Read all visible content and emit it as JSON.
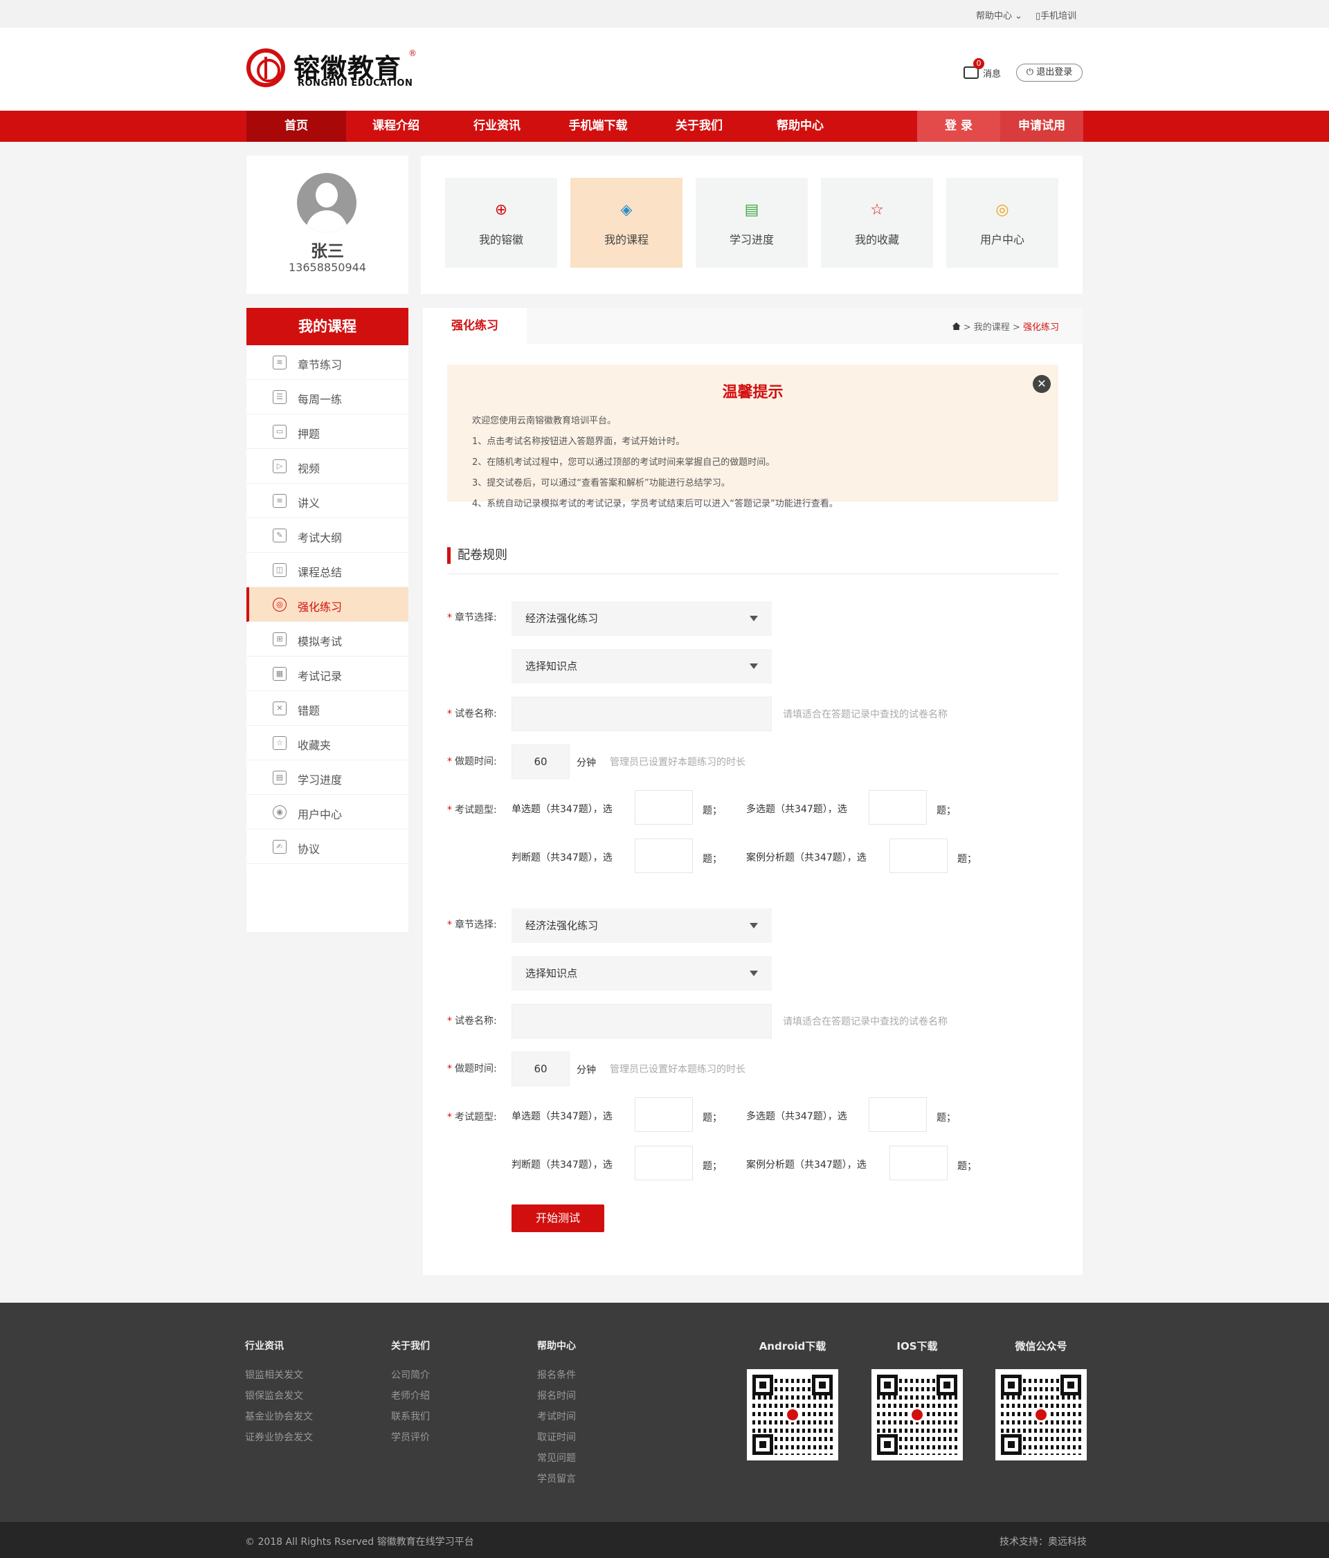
{
  "topbar": {
    "help": "帮助中心",
    "mobile": "手机培训"
  },
  "brand": {
    "name_cn": "镕徽教育",
    "name_en": "RONGHUI EDUCATION",
    "reg": "®",
    "color": "#d20f0f"
  },
  "header": {
    "message_label": "消息",
    "message_count": "0",
    "logout": "退出登录"
  },
  "nav": {
    "items": [
      "首页",
      "课程介绍",
      "行业资讯",
      "手机端下载",
      "关于我们",
      "帮助中心"
    ],
    "active_index": 0,
    "login": "登 录",
    "trial": "申请试用"
  },
  "profile": {
    "name": "张三",
    "phone": "13658850944"
  },
  "tiles": [
    {
      "label": "我的镕徽",
      "icon": "ronghui-logo-icon"
    },
    {
      "label": "我的课程",
      "icon": "layers-icon"
    },
    {
      "label": "学习进度",
      "icon": "progress-icon"
    },
    {
      "label": "我的收藏",
      "icon": "star-icon"
    },
    {
      "label": "用户中心",
      "icon": "user-icon"
    }
  ],
  "tiles_active_index": 1,
  "sidebar": {
    "title": "我的课程",
    "items": [
      "章节练习",
      "每周一练",
      "押题",
      "视频",
      "讲义",
      "考试大纲",
      "课程总结",
      "强化练习",
      "模拟考试",
      "考试记录",
      "错题",
      "收藏夹",
      "学习进度",
      "用户中心",
      "协议"
    ],
    "active_index": 7
  },
  "main": {
    "tab": "强化练习",
    "breadcrumb": [
      "我的课程",
      "强化练习"
    ]
  },
  "notice": {
    "title": "温馨提示",
    "lines": [
      "欢迎您使用云南镕徽教育培训平台。",
      "1、点击考试名称按钮进入答题界面，考试开始计时。",
      "2、在随机考试过程中，您可以通过顶部的考试时间来掌握自己的做题时间。",
      "3、提交试卷后，可以通过“查看答案和解析”功能进行总结学习。",
      "4、系统自动记录模拟考试的考试记录，学员考试结束后可以进入“答题记录”功能进行查看。"
    ]
  },
  "section_title": "配卷规则",
  "form": {
    "chapter_label": "章节选择:",
    "chapter_value": "经济法强化练习",
    "knowledge_value": "选择知识点",
    "paper_label": "试卷名称:",
    "paper_placeholder": "请填适合在答题记录中查找的试卷名称",
    "time_label": "做题时间:",
    "time_value": "60",
    "time_unit": "分钟",
    "time_hint": "管理员已设置好本题练习的时长",
    "type_label": "考试题型:",
    "single": "单选题（共347题），选",
    "multi": "多选题（共347题），选",
    "judge": "判断题（共347题），选",
    "case": "案例分析题（共347题），选",
    "unit": "题；"
  },
  "start_button": "开始测试",
  "footer": {
    "cols": [
      {
        "title": "行业资讯",
        "links": [
          "银监相关发文",
          "银保监会发文",
          "基金业协会发文",
          "证券业协会发文"
        ]
      },
      {
        "title": "关于我们",
        "links": [
          "公司简介",
          "老师介绍",
          "联系我们",
          "学员评价"
        ]
      },
      {
        "title": "帮助中心",
        "links": [
          "报名条件",
          "报名时间",
          "考试时间",
          "取证时间",
          "常见问题",
          "学员留言"
        ]
      }
    ],
    "qrs": [
      "Android下载",
      "IOS下载",
      "微信公众号"
    ],
    "copyright": "© 2018 All Rights Rserved  镕徽教育在线学习平台",
    "support": "技术支持：奥远科技"
  }
}
